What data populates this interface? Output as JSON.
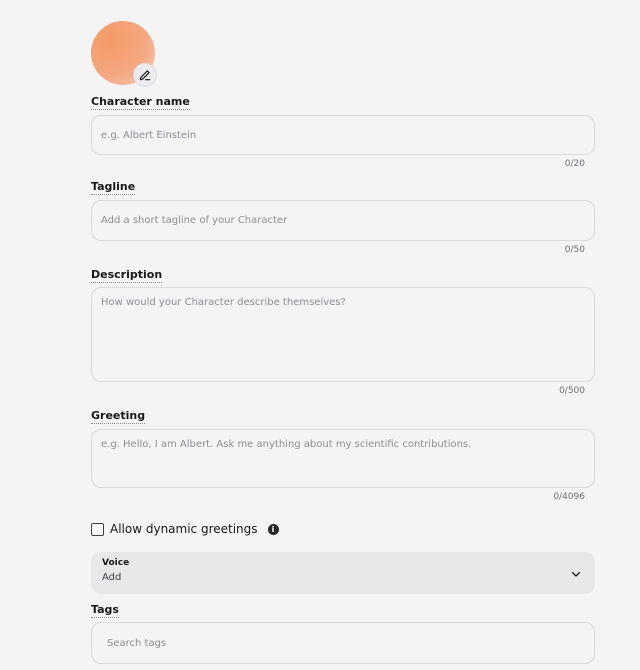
{
  "avatar": {
    "gradient_start": "#f39a66",
    "gradient_end": "#f6cdbd",
    "edit_icon": "pencil-icon"
  },
  "name": {
    "label": "Character name",
    "placeholder": "e.g. Albert Einstein",
    "counter": "0/20"
  },
  "tagline": {
    "label": "Tagline",
    "placeholder": "Add a short tagline of your Character",
    "counter": "0/50"
  },
  "description": {
    "label": "Description",
    "placeholder": "How would your Character describe themselves?",
    "counter": "0/500"
  },
  "greeting": {
    "label": "Greeting",
    "placeholder": "e.g. Hello, I am Albert. Ask me anything about my scientific contributions.",
    "counter": "0/4096"
  },
  "dynamic_greetings": {
    "label": "Allow dynamic greetings",
    "checked": false,
    "info_icon": "info-icon"
  },
  "voice": {
    "title": "Voice",
    "value": "Add",
    "chevron_icon": "chevron-down-icon"
  },
  "tags": {
    "label": "Tags",
    "placeholder": "Search tags"
  }
}
